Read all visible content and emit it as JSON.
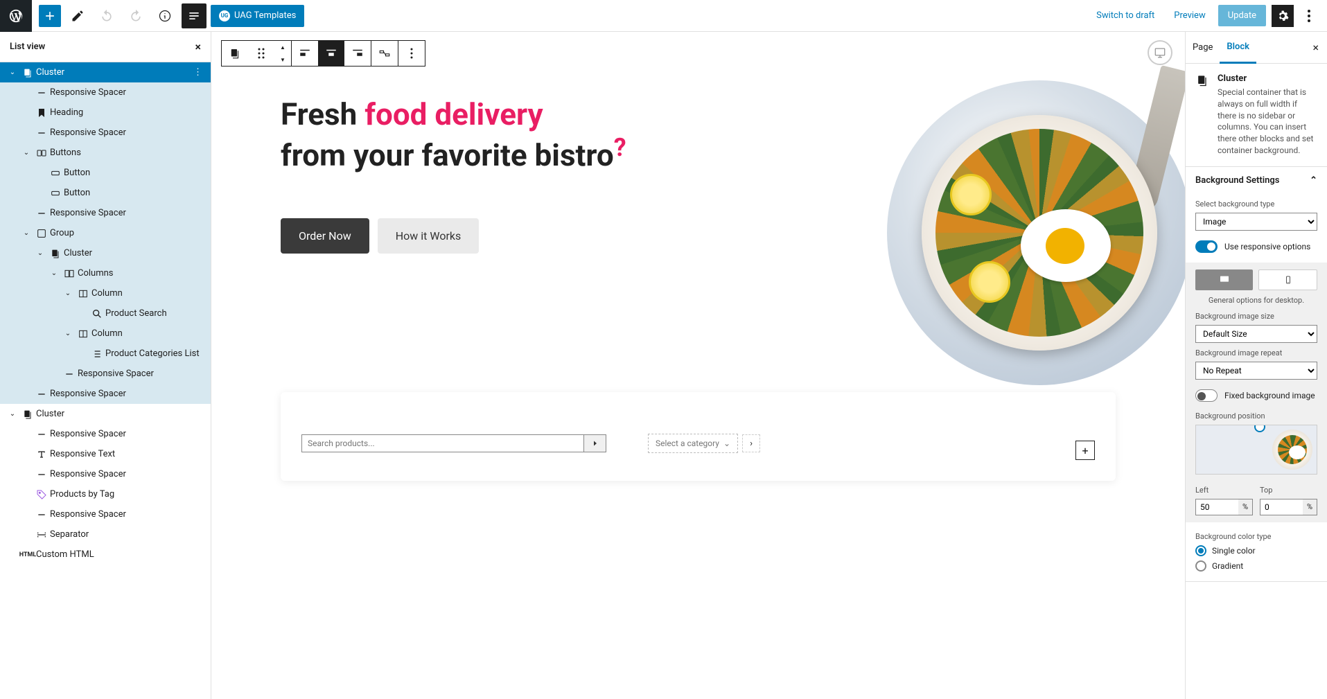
{
  "topbar": {
    "uag_label": "UAG Templates",
    "switch_draft": "Switch to draft",
    "preview": "Preview",
    "update": "Update"
  },
  "listview": {
    "title": "List view",
    "items": [
      {
        "label": "Cluster",
        "depth": 0,
        "icon": "cluster",
        "selected": true,
        "chev": "down",
        "more": true
      },
      {
        "label": "Responsive Spacer",
        "depth": 1,
        "icon": "minus",
        "child": true
      },
      {
        "label": "Heading",
        "depth": 1,
        "icon": "bookmark",
        "child": true
      },
      {
        "label": "Responsive Spacer",
        "depth": 1,
        "icon": "minus",
        "child": true
      },
      {
        "label": "Buttons",
        "depth": 1,
        "icon": "buttons",
        "child": true,
        "chev": "down"
      },
      {
        "label": "Button",
        "depth": 2,
        "icon": "button",
        "child": true
      },
      {
        "label": "Button",
        "depth": 2,
        "icon": "button",
        "child": true
      },
      {
        "label": "Responsive Spacer",
        "depth": 1,
        "icon": "minus",
        "child": true
      },
      {
        "label": "Group",
        "depth": 1,
        "icon": "group",
        "child": true,
        "chev": "down"
      },
      {
        "label": "Cluster",
        "depth": 2,
        "icon": "cluster",
        "child": true,
        "chev": "down"
      },
      {
        "label": "Columns",
        "depth": 3,
        "icon": "columns",
        "child": true,
        "chev": "down"
      },
      {
        "label": "Column",
        "depth": 4,
        "icon": "column",
        "child": true,
        "chev": "down"
      },
      {
        "label": "Product Search",
        "depth": 5,
        "icon": "search",
        "child": true
      },
      {
        "label": "Column",
        "depth": 4,
        "icon": "column",
        "child": true,
        "chev": "down"
      },
      {
        "label": "Product Categories List",
        "depth": 5,
        "icon": "list",
        "child": true
      },
      {
        "label": "Responsive Spacer",
        "depth": 3,
        "icon": "minus",
        "child": true
      },
      {
        "label": "Responsive Spacer",
        "depth": 1,
        "icon": "minus",
        "child": true
      },
      {
        "label": "Cluster",
        "depth": 0,
        "icon": "cluster",
        "chev": "down"
      },
      {
        "label": "Responsive Spacer",
        "depth": 1,
        "icon": "minus"
      },
      {
        "label": "Responsive Text",
        "depth": 1,
        "icon": "text"
      },
      {
        "label": "Responsive Spacer",
        "depth": 1,
        "icon": "minus"
      },
      {
        "label": "Products by Tag",
        "depth": 1,
        "icon": "tag"
      },
      {
        "label": "Responsive Spacer",
        "depth": 1,
        "icon": "minus"
      },
      {
        "label": "Separator",
        "depth": 1,
        "icon": "sep"
      },
      {
        "label": "Custom HTML",
        "depth": 0,
        "icon": "html"
      }
    ]
  },
  "hero": {
    "line1_plain": "Fresh ",
    "line1_accent": "food delivery",
    "line2": "from your favorite bistro",
    "qmark": "?",
    "btn_primary": "Order Now",
    "btn_secondary": "How it Works"
  },
  "search": {
    "placeholder": "Search products...",
    "category": "Select a category"
  },
  "sidebar": {
    "tab_page": "Page",
    "tab_block": "Block",
    "block_name": "Cluster",
    "block_desc": "Special container that is always on full width if there is no sidebar or columns. You can insert there other blocks and set container background.",
    "bg_section": "Background Settings",
    "bg_type_label": "Select background type",
    "bg_type_value": "Image",
    "responsive": "Use responsive options",
    "general_caption": "General options for desktop.",
    "img_size_label": "Background image size",
    "img_size_value": "Default Size",
    "img_repeat_label": "Background image repeat",
    "img_repeat_value": "No Repeat",
    "fixed_bg": "Fixed background image",
    "bg_pos": "Background position",
    "left_label": "Left",
    "left_value": "50",
    "top_label": "Top",
    "top_value": "0",
    "unit": "%",
    "color_type_label": "Background color type",
    "color_single": "Single color",
    "color_gradient": "Gradient"
  }
}
